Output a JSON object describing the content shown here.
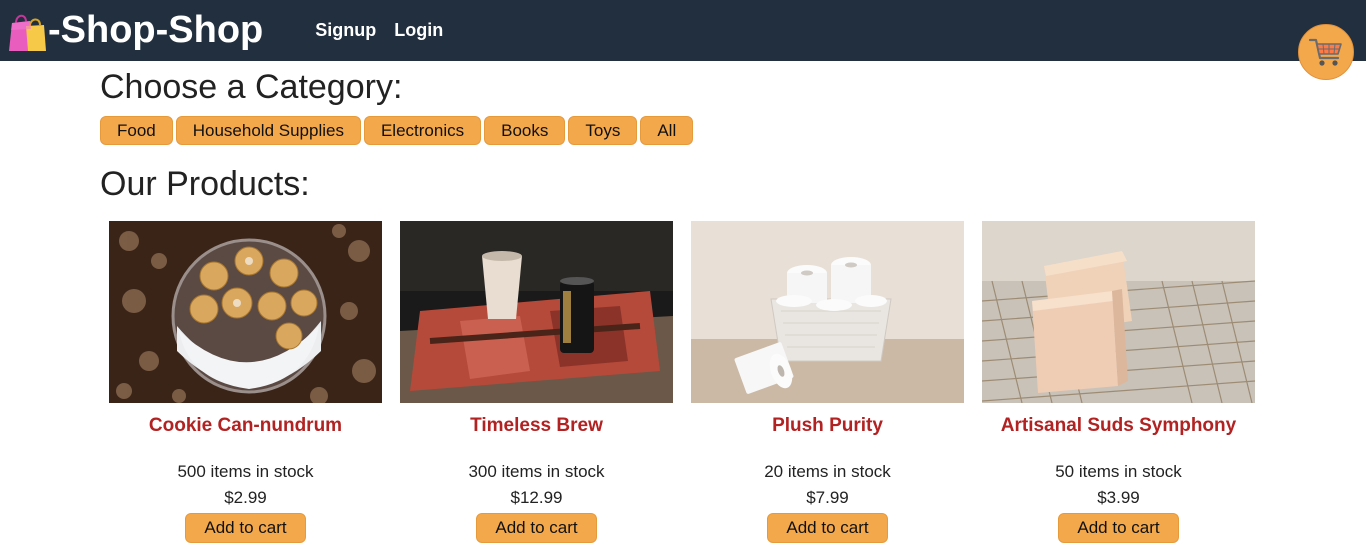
{
  "header": {
    "brand_text": "-Shop-Shop",
    "nav": {
      "signup": "Signup",
      "login": "Login"
    }
  },
  "categories": {
    "heading": "Choose a Category:",
    "items": [
      "Food",
      "Household Supplies",
      "Electronics",
      "Books",
      "Toys",
      "All"
    ]
  },
  "products": {
    "heading": "Our Products:",
    "items": [
      {
        "name": "Cookie Can-nundrum",
        "stock": "500 items in stock",
        "price": "$2.99",
        "button": "Add to cart"
      },
      {
        "name": "Timeless Brew",
        "stock": "300 items in stock",
        "price": "$12.99",
        "button": "Add to cart"
      },
      {
        "name": "Plush Purity",
        "stock": "20 items in stock",
        "price": "$7.99",
        "button": "Add to cart"
      },
      {
        "name": "Artisanal Suds Symphony",
        "stock": "50 items in stock",
        "price": "$3.99",
        "button": "Add to cart"
      }
    ]
  },
  "icons": {
    "brand": "shopping-bags-icon",
    "cart": "shopping-cart-icon"
  },
  "colors": {
    "header_bg": "#222f3e",
    "accent": "#f4a84c",
    "product_name": "#b22222"
  }
}
